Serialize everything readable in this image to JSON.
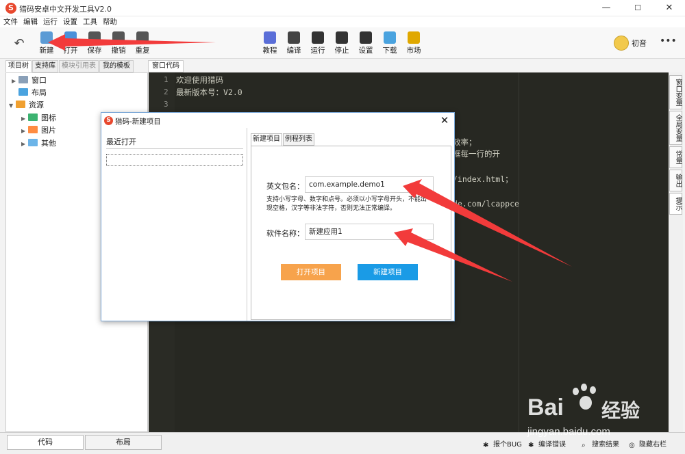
{
  "window": {
    "title": "猎码安卓中文开发工具V2.0",
    "logo_char": "S",
    "min": "—",
    "max": "☐",
    "close": "✕"
  },
  "menu": [
    "文件",
    "编辑",
    "运行",
    "设置",
    "工具",
    "帮助"
  ],
  "toolbar": {
    "back": "↶",
    "left_buttons": [
      {
        "label": "新建",
        "icon": "new-file-icon",
        "color": "#5b9bd5"
      },
      {
        "label": "打开",
        "icon": "open-folder-icon",
        "color": "#4a90d9"
      },
      {
        "label": "保存",
        "icon": "save-icon",
        "color": "#555555"
      },
      {
        "label": "撤销",
        "icon": "undo-icon",
        "color": "#555555"
      },
      {
        "label": "重复",
        "icon": "redo-icon",
        "color": "#555555"
      }
    ],
    "center_buttons": [
      {
        "label": "教程",
        "icon": "tutorial-icon",
        "color": "#5a6ed8"
      },
      {
        "label": "编译",
        "icon": "compile-icon",
        "color": "#444444"
      },
      {
        "label": "运行",
        "icon": "run-icon",
        "color": "#333333"
      },
      {
        "label": "停止",
        "icon": "stop-icon",
        "color": "#333333"
      },
      {
        "label": "设置",
        "icon": "settings-icon",
        "color": "#333333"
      },
      {
        "label": "下载",
        "icon": "download-icon",
        "color": "#4aa3df"
      },
      {
        "label": "市场",
        "icon": "market-icon",
        "color": "#e0a800"
      }
    ],
    "user": "初音",
    "more": "•••"
  },
  "left_tabs": [
    "项目树",
    "支持库",
    "模块引用表",
    "我的模板"
  ],
  "tree": [
    {
      "label": "窗口",
      "arrow": "▶",
      "color": "#8aa0b8"
    },
    {
      "label": "布局",
      "arrow": "",
      "color": "#4aa3df"
    },
    {
      "label": "资源",
      "arrow": "▼",
      "color": "#f0a030"
    },
    {
      "label": "图标",
      "arrow": "▶",
      "color": "#3cb371"
    },
    {
      "label": "图片",
      "arrow": "▶",
      "color": "#ff8c42"
    },
    {
      "label": "其他",
      "arrow": "▶",
      "color": "#6cb4e8"
    }
  ],
  "editor": {
    "tab": "窗口代码",
    "lines": [
      {
        "num": "1",
        "text": "欢迎使用猎码"
      },
      {
        "num": "2",
        "text": "最新版本号：V2.0"
      },
      {
        "num": "3",
        "text": ""
      }
    ],
    "fragments": [
      "效率；",
      "框每一行的开",
      "/index.html；",
      "de.com/lcappce"
    ]
  },
  "right_tabs": [
    "窗口变量",
    "全局变量",
    "常量",
    "输出",
    "提示"
  ],
  "bottom": {
    "tabs": [
      "代码",
      "布局"
    ],
    "status": [
      {
        "label": "报个BUG",
        "icon": "bug-icon",
        "glyph": "✱"
      },
      {
        "label": "编译错误",
        "icon": "compile-error-icon",
        "glyph": "✱"
      },
      {
        "label": "搜索结果",
        "icon": "search-icon",
        "glyph": "⌕"
      },
      {
        "label": "隐藏右栏",
        "icon": "hide-icon",
        "glyph": "◎"
      }
    ]
  },
  "dialog": {
    "title": "猎码-新建项目",
    "close": "✕",
    "recent_title": "最近打开",
    "tabs": [
      "新建项目",
      "例程列表"
    ],
    "package_label": "英文包名：",
    "package_value": "com.example.demo1",
    "hint1": "支持小写字母、数字和点号。必须以小写字母开头，不能出",
    "hint2": "现空格，汉字等非法字符，否则无法正常编译。",
    "name_label": "软件名称：",
    "name_value": "新建应用1",
    "open_btn": "打开项目",
    "create_btn": "新建项目",
    "open_color": "#f7a34c",
    "create_color": "#1a9be6"
  },
  "watermark": {
    "brand": "Bai",
    "brand2": "经验",
    "url": "jingyan.baidu.com"
  },
  "colors": {
    "arrow": "#f23b3b",
    "editor_bg": "#272822"
  }
}
